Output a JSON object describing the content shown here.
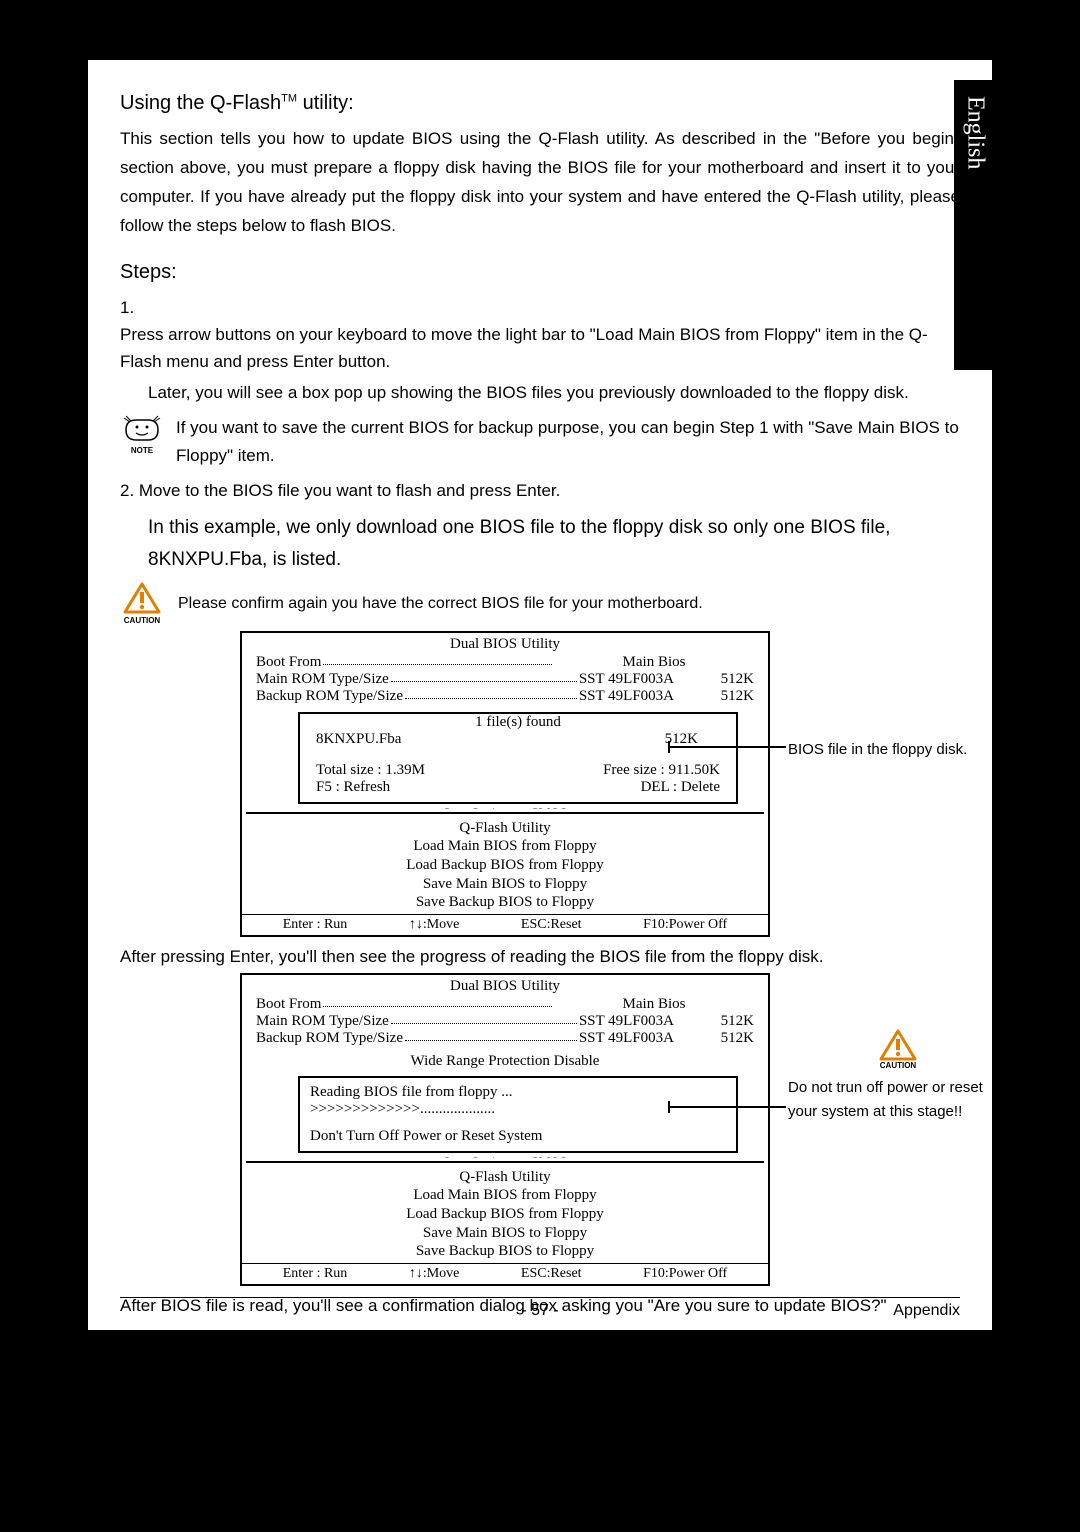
{
  "langTab": "English",
  "heading1_pre": "Using the Q-Flash",
  "heading1_sup": "TM",
  "heading1_post": " utility:",
  "intro": "This section tells you how to update BIOS using the Q-Flash utility. As described in the \"Before you begin\" section above, you must prepare a floppy disk having the BIOS file for your motherboard and insert it to your computer. If you have already put the floppy disk into your system and have entered the Q-Flash utility, please follow the steps below to flash BIOS.",
  "stepsHeading": "Steps:",
  "step1_num": "1.",
  "step1_text": "Press arrow buttons on your keyboard to move the light bar to \"Load Main BIOS from Floppy\" item in the Q-Flash menu and press Enter button.",
  "step1_later": "Later, you will see a box pop up showing the BIOS files you previously downloaded to the floppy disk.",
  "noteLabel": "NOTE",
  "noteText": "If you want to save the current BIOS for backup purpose, you can begin Step 1 with \"Save Main BIOS to Floppy\" item.",
  "step2_pre": "2. Move to the BIOS file you want to flash and press ",
  "step2_enter": "Enter",
  "step2_post": ".",
  "exampleText": "In this example, we only download one BIOS file to the floppy disk so only one BIOS file, 8KNXPU.Fba, is listed.",
  "cautionLabel": "CAUTION",
  "cautionText": "Please confirm again you have the correct BIOS file for your motherboard.",
  "bios": {
    "title": "Dual BIOS Utility",
    "bootFromLabel": "Boot From",
    "bootFromVal": "Main Bios",
    "mainRomLabel": "Main ROM Type/Size",
    "mainRomVal": "SST 49LF003A",
    "mainRomSize": "512K",
    "backupRomLabel": "Backup ROM Type/Size",
    "backupRomVal": "SST 49LF003A",
    "backupRomSize": "512K",
    "wideRangePartial": "Wide Range Prot",
    "wideRangeFull": "Wide Range Protection    Disable",
    "filesFound": "1 file(s) found",
    "fileName": "8KNXPU.Fba",
    "fileSize": "512K",
    "totalSize": "Total size : 1.39M",
    "freeSize": "Free size : 911.50K",
    "f5": "F5 : Refresh",
    "del": "DEL : Delete",
    "reading": "Reading BIOS file from floppy ...",
    "progress": ">>>>>>>>>>>>>....................",
    "dontTurnOff": "Don't Turn Off Power or Reset System",
    "cutText": "Save Settings to CMOS",
    "qflashTitle": "Q-Flash Utility",
    "menu1": "Load Main BIOS from Floppy",
    "menu2": "Load Backup BIOS from Floppy",
    "menu3": "Save Main BIOS to Floppy",
    "menu4": "Save Backup BIOS to Floppy",
    "kEnter": "Enter : Run",
    "kMove": "↑↓:Move",
    "kEsc": "ESC:Reset",
    "kF10": "F10:Power Off"
  },
  "anno1": "BIOS file in the floppy disk.",
  "anno2": "Do not trun off power or reset your system at this stage!!",
  "afterPress_pre": "After pressing ",
  "afterPress_enter": "Enter",
  "afterPress_post": ", you'll then see the progress of reading the BIOS file from the floppy disk.",
  "afterRead": "After BIOS file is read, you'll see a confirmation dialog box asking you \"Are you sure to update BIOS?\"",
  "pageNum": "- 57 -",
  "appendix": "Appendix"
}
